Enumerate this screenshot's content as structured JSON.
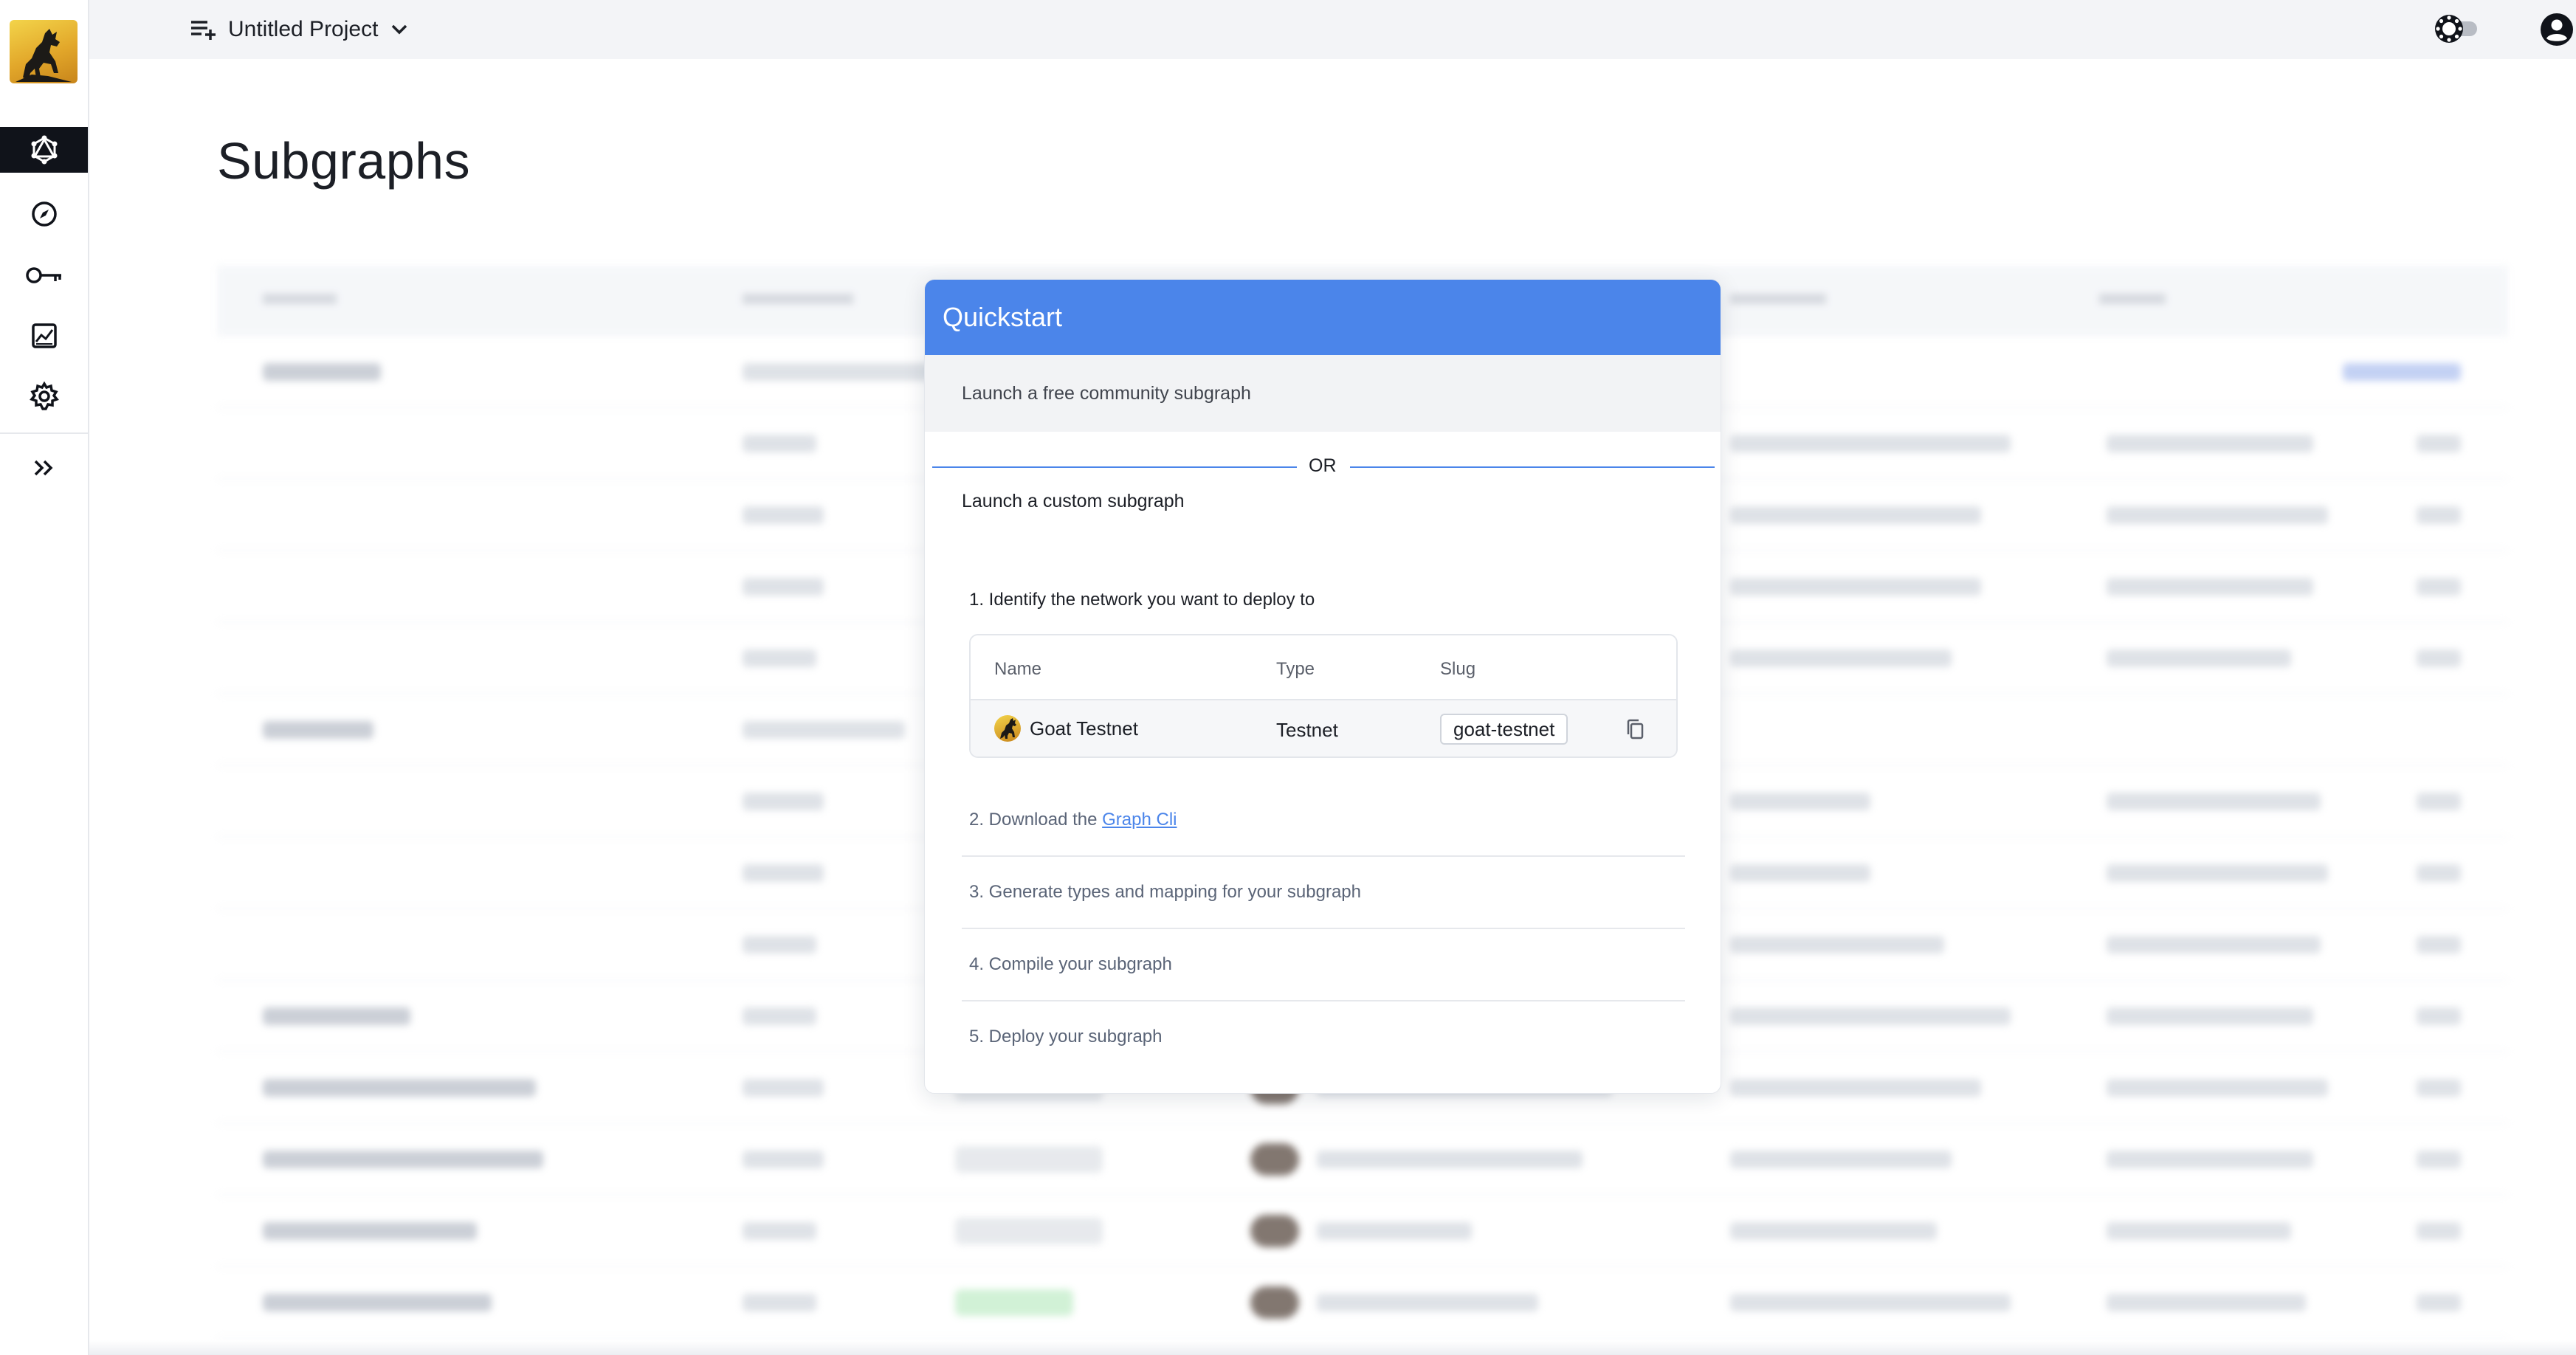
{
  "app": {
    "logo_name": "goat-logo",
    "project_selector": {
      "label": "Untitled Project"
    }
  },
  "sidebar": {
    "items": [
      {
        "name": "subgraphs",
        "icon": "graph-icon",
        "active": true
      },
      {
        "name": "explorer",
        "icon": "compass-icon",
        "active": false
      },
      {
        "name": "api-keys",
        "icon": "key-icon",
        "active": false
      },
      {
        "name": "analytics",
        "icon": "chart-icon",
        "active": false
      },
      {
        "name": "settings",
        "icon": "gear-icon",
        "active": false
      },
      {
        "name": "expand",
        "icon": "double-chevron-right-icon",
        "active": false
      }
    ]
  },
  "header": {
    "theme_toggle_icon": "sun-toggle-icon",
    "account_icon": "account-circle-icon"
  },
  "page": {
    "title": "Subgraphs"
  },
  "modal": {
    "title": "Quickstart",
    "free_option": "Launch a free community subgraph",
    "divider_text": "OR",
    "custom_option": "Launch a custom subgraph",
    "step1": "1. Identify the network you want to deploy to",
    "network_table": {
      "columns": [
        "Name",
        "Type",
        "Slug"
      ],
      "rows": [
        {
          "name": "Goat Testnet",
          "type": "Testnet",
          "slug": "goat-testnet"
        }
      ]
    },
    "step2_prefix": "2. Download the ",
    "step2_link": "Graph Cli",
    "step3": "3. Generate types and mapping for your subgraph",
    "step4": "4. Compile your subgraph",
    "step5": "5. Deploy your subgraph"
  },
  "colors": {
    "accent": "#4b85ea",
    "sidebar_active": "#10131a",
    "topbar_bg": "#f3f4f7"
  }
}
